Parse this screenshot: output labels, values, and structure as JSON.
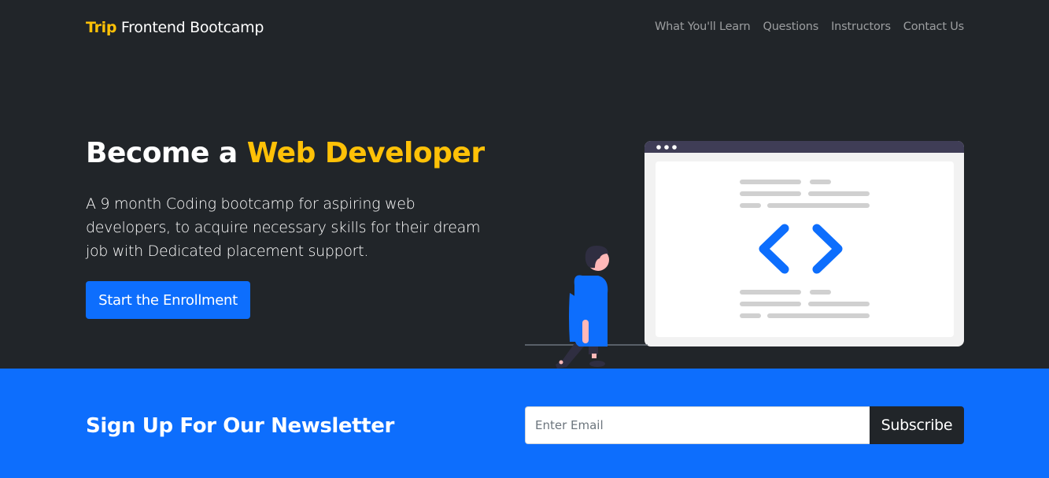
{
  "nav": {
    "brand_highlight": "Trip",
    "brand_rest": "Frontend Bootcamp",
    "links": [
      "What You'll Learn",
      "Questions",
      "Instructors",
      "Contact Us"
    ]
  },
  "hero": {
    "title_prefix": "Become a",
    "title_highlight": "Web Developer",
    "description": "A 9 month Coding bootcamp for aspiring web developers, to acquire necessary skills for their dream job with Dedicated placement support.",
    "cta_label": "Start the Enrollment",
    "illustration": "developer-coding-illustration"
  },
  "newsletter": {
    "title": "Sign Up For Our Newsletter",
    "email_placeholder": "Enter Email",
    "email_value": "",
    "subscribe_label": "Subscribe"
  },
  "colors": {
    "dark": "#212529",
    "accent": "#ffc107",
    "primary": "#0d6efd"
  }
}
